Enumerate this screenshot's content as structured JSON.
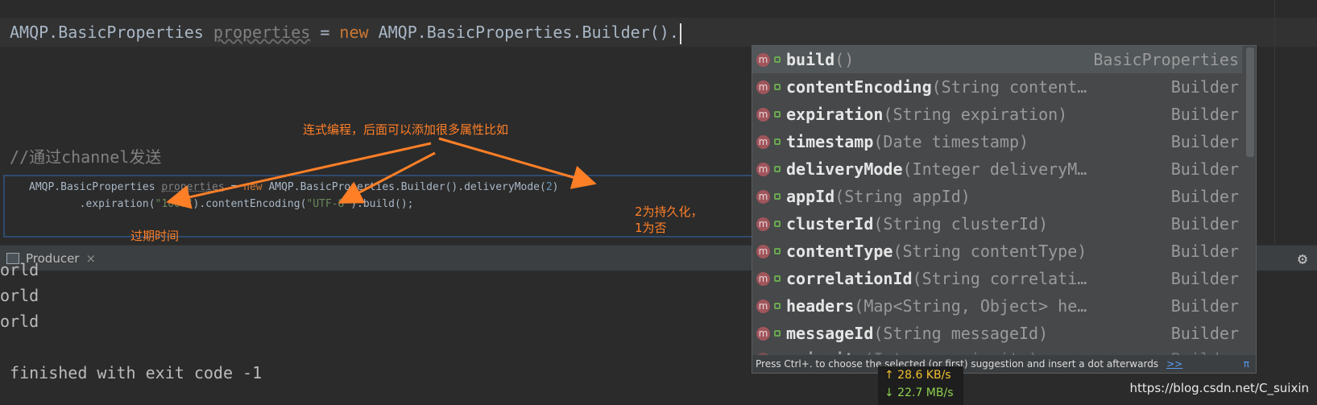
{
  "editor": {
    "line_prefix": "AMQP.BasicProperties ",
    "line_var": "properties",
    "line_eq": " = ",
    "line_new": "new",
    "line_suffix": " AMQP.BasicProperties.Builder().",
    "comment": "//通过channel发送"
  },
  "snippet": {
    "l1_a": "AMQP.BasicProperties ",
    "l1_var": "properties",
    "l1_b": " = ",
    "l1_new": "new",
    "l1_c": " AMQP.BasicProperties.Builder().deliveryMode(",
    "l1_num": "2",
    "l1_d": ")",
    "l2_a": "        .expiration(",
    "l2_str1": "\"1000\"",
    "l2_b": ").contentEncoding(",
    "l2_str2": "\"UTF-8\"",
    "l2_c": ").build();"
  },
  "annotations": {
    "chain": "连式编程，后面可以添加很多属性比如",
    "expire": "过期时间",
    "persist_1": "2为持久化，",
    "persist_2": "1为否"
  },
  "run_panel": {
    "tab_label": "Producer",
    "close": "×"
  },
  "console": {
    "lines": [
      "orld",
      "orld",
      "orld",
      "",
      " finished with exit code -1"
    ]
  },
  "completion": {
    "items": [
      {
        "name": "build",
        "params": "()",
        "type": "BasicProperties",
        "selected": true
      },
      {
        "name": "contentEncoding",
        "params": "(String content…",
        "type": "Builder"
      },
      {
        "name": "expiration",
        "params": "(String expiration)",
        "type": "Builder"
      },
      {
        "name": "timestamp",
        "params": "(Date timestamp)",
        "type": "Builder"
      },
      {
        "name": "deliveryMode",
        "params": "(Integer deliveryM…",
        "type": "Builder"
      },
      {
        "name": "appId",
        "params": "(String appId)",
        "type": "Builder"
      },
      {
        "name": "clusterId",
        "params": "(String clusterId)",
        "type": "Builder"
      },
      {
        "name": "contentType",
        "params": "(String contentType)",
        "type": "Builder"
      },
      {
        "name": "correlationId",
        "params": "(String correlati…",
        "type": "Builder"
      },
      {
        "name": "headers",
        "params": "(Map<String, Object> he…",
        "type": "Builder"
      },
      {
        "name": "messageId",
        "params": "(String messageId)",
        "type": "Builder"
      },
      {
        "name": "priority",
        "params": "(Integer priority)",
        "type": "Builder"
      }
    ],
    "footer": "Press Ctrl+. to choose the selected (or first) suggestion and insert a dot afterwards",
    "footer_link": ">>",
    "footer_pi": "π"
  },
  "network": {
    "up": "↑ 28.6 KB/s",
    "down": "↓ 22.7 MB/s"
  },
  "watermark": "https://blog.csdn.net/C_suixin",
  "colors": {
    "keyword": "#cc7832",
    "string": "#6a8759",
    "number": "#6897bb",
    "annotation": "#ff7f27",
    "popup_bg": "#46484a"
  }
}
